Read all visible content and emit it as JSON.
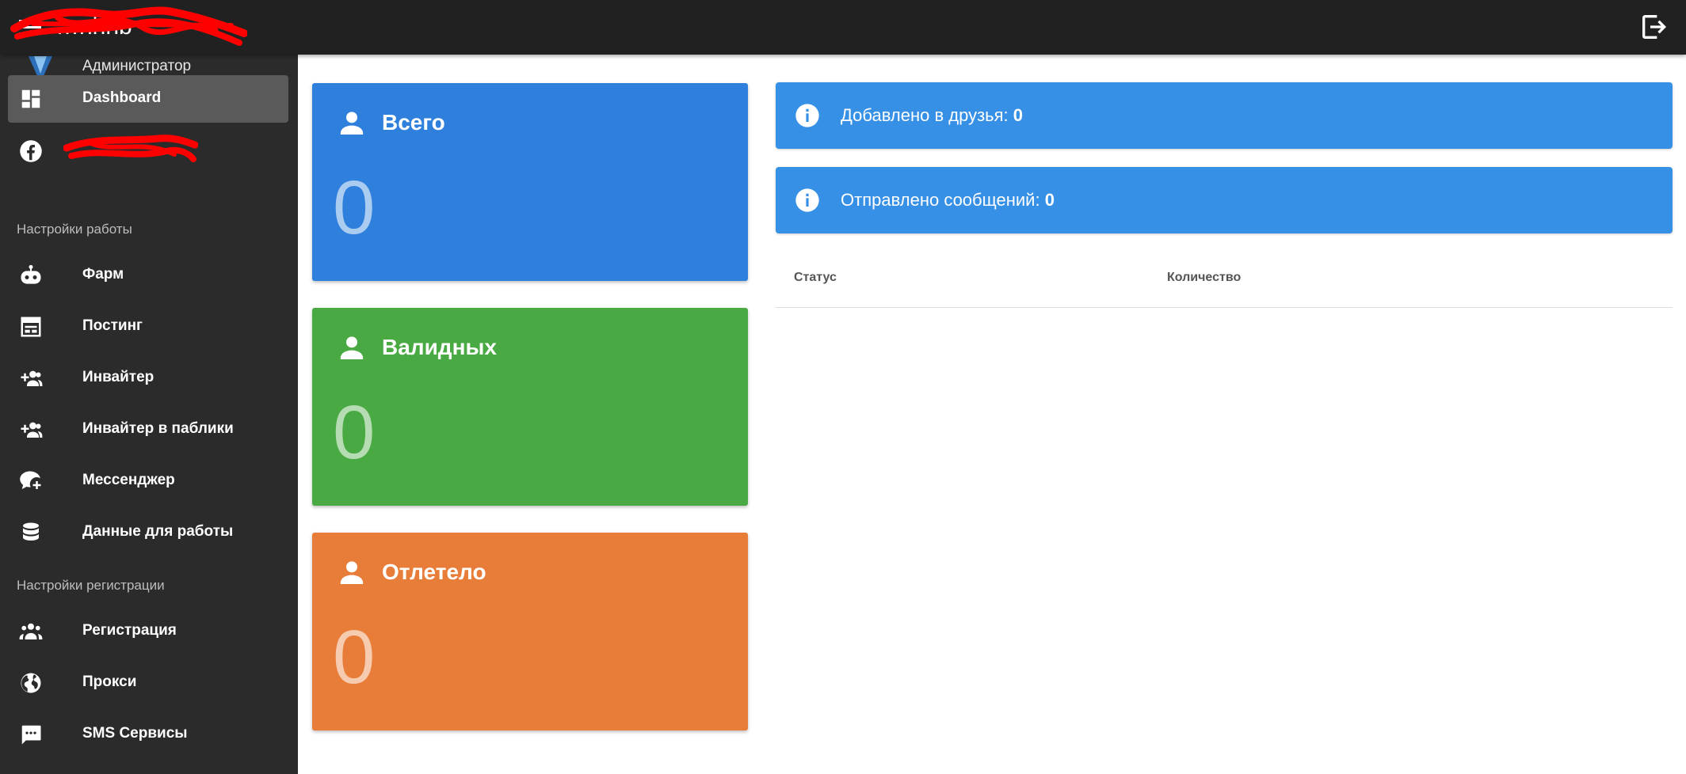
{
  "header": {
    "title": "…nhhb",
    "menu_icon": "menu-icon",
    "logout_icon": "logout-icon"
  },
  "sidebar": {
    "user": {
      "name": "Администратор",
      "logo_color": "#4a90d9"
    },
    "items_top": [
      {
        "label": "Dashboard",
        "icon": "dashboard-icon",
        "active": true
      },
      {
        "label": "",
        "icon": "facebook-icon",
        "active": false
      }
    ],
    "section_work": "Настройки работы",
    "items_work": [
      {
        "label": "Фарм",
        "icon": "robot-icon"
      },
      {
        "label": "Постинг",
        "icon": "calendar-icon"
      },
      {
        "label": "Инвайтер",
        "icon": "add-group-icon"
      },
      {
        "label": "Инвайтер в паблики",
        "icon": "add-group-icon"
      },
      {
        "label": "Мессенджер",
        "icon": "chat-plus-icon"
      },
      {
        "label": "Данные для работы",
        "icon": "database-icon"
      }
    ],
    "section_registration": "Настройки регистрации",
    "items_registration": [
      {
        "label": "Регистрация",
        "icon": "group-icon"
      },
      {
        "label": "Прокси",
        "icon": "globe-icon"
      },
      {
        "label": "SMS Сервисы",
        "icon": "sms-icon"
      }
    ]
  },
  "cards": [
    {
      "title": "Всего",
      "value": "0",
      "color": "#2f80dd",
      "icon": "person-icon"
    },
    {
      "title": "Валидных",
      "value": "0",
      "color": "#49a942",
      "icon": "person-icon"
    },
    {
      "title": "Отлетело",
      "value": "0",
      "color": "#e87d39",
      "icon": "person-icon"
    }
  ],
  "alerts": [
    {
      "label": "Добавлено в друзья: ",
      "value": "0",
      "icon": "info-icon"
    },
    {
      "label": "Отправлено сообщений: ",
      "value": "0",
      "icon": "info-icon"
    }
  ],
  "table": {
    "columns": [
      "Статус",
      "Количество"
    ]
  },
  "colors": {
    "topbar": "#212121",
    "sidebar": "#2b2b2b",
    "alert": "#3690e6",
    "redaction": "#ff0000"
  }
}
